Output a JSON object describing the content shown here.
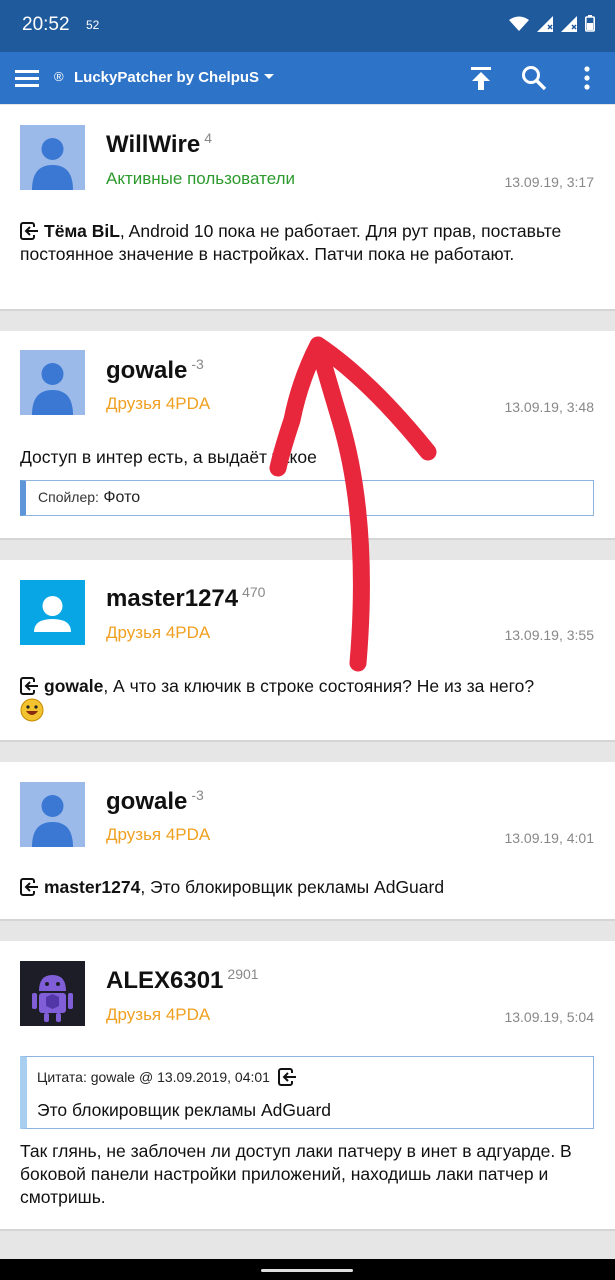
{
  "status_bar": {
    "time": "20:52",
    "badge": "52"
  },
  "app_bar": {
    "title": "LuckyPatcher by ChelpuS",
    "reg_mark": "®"
  },
  "posts": [
    {
      "username": "WillWire",
      "reputation": "4",
      "group": "Активные пользователи",
      "date": "13.09.19, 3:17",
      "reply_to": "Тёма BiL",
      "text": ", Android 10 пока не работает. Для рут прав, поставьте постоянное значение в настройках. Патчи пока не работают."
    },
    {
      "username": "gowale",
      "reputation": "-3",
      "group": "Друзья 4PDA",
      "date": "13.09.19, 3:48",
      "text": "Доступ в интер есть, а выдаёт такое",
      "spoiler_label": "Спойлер:",
      "spoiler_title": "Фото"
    },
    {
      "username": "master1274",
      "reputation": "470",
      "group": "Друзья 4PDA",
      "date": "13.09.19, 3:55",
      "reply_to": "gowale",
      "text": ", А что за ключик в строке состояния? Не из за него?"
    },
    {
      "username": "gowale",
      "reputation": "-3",
      "group": "Друзья 4PDA",
      "date": "13.09.19, 4:01",
      "reply_to": "master1274",
      "text": ", Это блокировщик рекламы AdGuard"
    },
    {
      "username": "ALEX6301",
      "reputation": "2901",
      "group": "Друзья 4PDA",
      "date": "13.09.19, 5:04",
      "quote_header": "Цитата: gowale @ 13.09.2019, 04:01",
      "quote_text": "Это блокировщик рекламы AdGuard",
      "text": "Так глянь, не заблочен ли доступ лаки патчеру в инет в адгуарде. В боковой панели настройки приложений, находишь лаки патчер и смотришь."
    }
  ],
  "colors": {
    "status_bar": "#1f5a9d",
    "app_bar": "#2d73c8",
    "group_active": "#2c9a2c",
    "group_friends": "#f0a020",
    "annotation_arrow": "#e8273d"
  }
}
